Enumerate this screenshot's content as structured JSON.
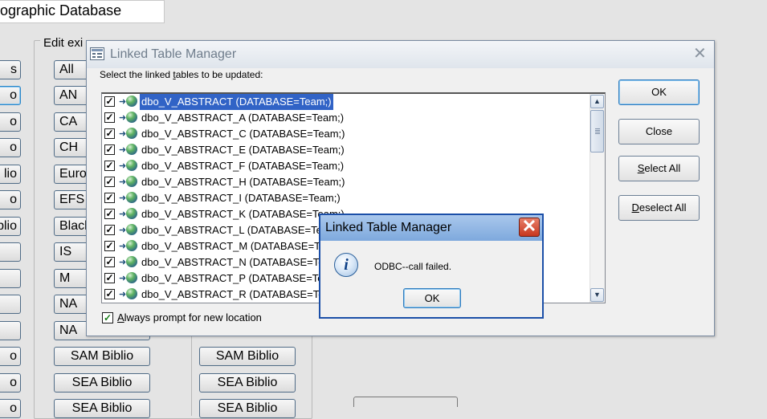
{
  "background_form": {
    "title": "ographic Database",
    "group_label": "Edit exi",
    "left_column": [
      "s",
      "o",
      "o",
      "o",
      "lio",
      "o",
      "blio",
      "",
      "",
      "",
      "",
      "o",
      "o",
      "o",
      "o"
    ],
    "middle_column": [
      "All",
      "AN",
      "CA",
      "CH",
      "Euro",
      "EFS",
      "Black",
      "IS",
      "M",
      "NA",
      "NA",
      "SAM Biblio",
      "SEA Biblio",
      "SEA Biblio"
    ],
    "right_column": [
      "SAM Biblio",
      "SEA Biblio",
      "SEA Biblio"
    ]
  },
  "linked_table_manager": {
    "title": "Linked Table Manager",
    "instruction_pre": "Select the linked ",
    "instruction_mnemonic": "t",
    "instruction_post": "ables to be updated:",
    "tables": [
      "dbo_V_ABSTRACT   (DATABASE=Team;)",
      "dbo_V_ABSTRACT_A   (DATABASE=Team;)",
      "dbo_V_ABSTRACT_C   (DATABASE=Team;)",
      "dbo_V_ABSTRACT_E   (DATABASE=Team;)",
      "dbo_V_ABSTRACT_F   (DATABASE=Team;)",
      "dbo_V_ABSTRACT_H   (DATABASE=Team;)",
      "dbo_V_ABSTRACT_I   (DATABASE=Team;)",
      "dbo_V_ABSTRACT_K   (DATABASE=Team;)",
      "dbo_V_ABSTRACT_L   (DATABASE=Team;)",
      "dbo_V_ABSTRACT_M   (DATABASE=Team;)",
      "dbo_V_ABSTRACT_N   (DATABASE=Team;)",
      "dbo_V_ABSTRACT_P   (DATABASE=Team;)",
      "dbo_V_ABSTRACT_R   (DATABASE=Team;)"
    ],
    "selected_table": "dbo_V_ABSTRACT   (DATABASE=Team;)",
    "checkbox_mark": "✓",
    "always_prompt": {
      "mnemonic": "A",
      "rest": "lways prompt for new location",
      "checked": true
    },
    "buttons": {
      "ok": "OK",
      "close": "Close",
      "select_all_mnemonic": "S",
      "select_all_rest": "elect All",
      "deselect_all_mnemonic": "D",
      "deselect_all_rest": "eselect All"
    }
  },
  "error_dialog": {
    "title": "Linked Table Manager",
    "message": "ODBC--call failed.",
    "ok": "OK",
    "icon": "info-icon"
  },
  "colors": {
    "selection": "#3163c6",
    "error_titlebar": "#7ea9dd",
    "close_button": "#c7371f"
  }
}
